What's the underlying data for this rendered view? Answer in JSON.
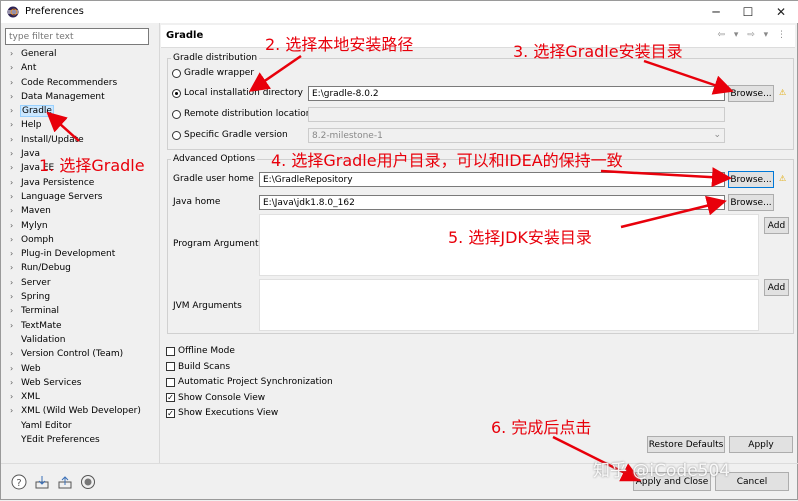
{
  "window": {
    "title": "Preferences",
    "minimize": "─",
    "maximize": "☐",
    "close": "✕"
  },
  "filter": {
    "placeholder": "type filter text"
  },
  "tree": [
    {
      "label": "General",
      "arrow": "›"
    },
    {
      "label": "Ant",
      "arrow": "›"
    },
    {
      "label": "Code Recommenders",
      "arrow": "›"
    },
    {
      "label": "Data Management",
      "arrow": "›"
    },
    {
      "label": "Gradle",
      "arrow": "›",
      "selected": true
    },
    {
      "label": "Help",
      "arrow": "›"
    },
    {
      "label": "Install/Update",
      "arrow": "›"
    },
    {
      "label": "Java",
      "arrow": "›"
    },
    {
      "label": "Java EE",
      "arrow": "›"
    },
    {
      "label": "Java Persistence",
      "arrow": "›"
    },
    {
      "label": "Language Servers",
      "arrow": "›"
    },
    {
      "label": "Maven",
      "arrow": "›"
    },
    {
      "label": "Mylyn",
      "arrow": "›"
    },
    {
      "label": "Oomph",
      "arrow": "›"
    },
    {
      "label": "Plug-in Development",
      "arrow": "›"
    },
    {
      "label": "Run/Debug",
      "arrow": "›"
    },
    {
      "label": "Server",
      "arrow": "›"
    },
    {
      "label": "Spring",
      "arrow": "›"
    },
    {
      "label": "Terminal",
      "arrow": "›"
    },
    {
      "label": "TextMate",
      "arrow": "›"
    },
    {
      "label": "Validation",
      "arrow": ""
    },
    {
      "label": "Version Control (Team)",
      "arrow": "›"
    },
    {
      "label": "Web",
      "arrow": "›"
    },
    {
      "label": "Web Services",
      "arrow": "›"
    },
    {
      "label": "XML",
      "arrow": "›"
    },
    {
      "label": "XML (Wild Web Developer)",
      "arrow": "›"
    },
    {
      "label": "Yaml Editor",
      "arrow": ""
    },
    {
      "label": "YEdit Preferences",
      "arrow": ""
    }
  ],
  "page": {
    "title": "Gradle",
    "nav": "⇦ ▾ ⇨ ▾ ⋮",
    "distribution": {
      "group_label": "Gradle distribution",
      "wrapper": "Gradle wrapper",
      "local": "Local installation directory",
      "local_value": "E:\\gradle-8.0.2",
      "remote": "Remote distribution location",
      "remote_value": "",
      "specific": "Specific Gradle version",
      "specific_value": "8.2-milestone-1",
      "browse": "Browse..."
    },
    "advanced": {
      "group_label": "Advanced Options",
      "user_home_label": "Gradle user home",
      "user_home_value": "E:\\GradleRepository",
      "java_home_label": "Java home",
      "java_home_value": "E:\\Java\\jdk1.8.0_162",
      "program_args_label": "Program Arguments",
      "jvm_args_label": "JVM Arguments",
      "browse": "Browse...",
      "add": "Add"
    },
    "checkboxes": [
      {
        "label": "Offline Mode",
        "checked": false
      },
      {
        "label": "Build Scans",
        "checked": false
      },
      {
        "label": "Automatic Project Synchronization",
        "checked": false
      },
      {
        "label": "Show Console View",
        "checked": true
      },
      {
        "label": "Show Executions View",
        "checked": true
      }
    ],
    "restore_defaults": "Restore Defaults",
    "apply": "Apply"
  },
  "footer": {
    "apply_close": "Apply and Close",
    "cancel": "Cancel"
  },
  "annotations": {
    "a1": "1. 选择Gradle",
    "a2": "2. 选择本地安装路径",
    "a3": "3. 选择Gradle安装目录",
    "a4": "4. 选择Gradle用户目录，可以和IDEA的保持一致",
    "a5": "5. 选择JDK安装目录",
    "a6": "6. 完成后点击"
  },
  "watermark": "知乎 @iCode504",
  "colors": {
    "annotation": "#e8000b",
    "selection": "#cce8ff",
    "focus": "#0078d7"
  }
}
